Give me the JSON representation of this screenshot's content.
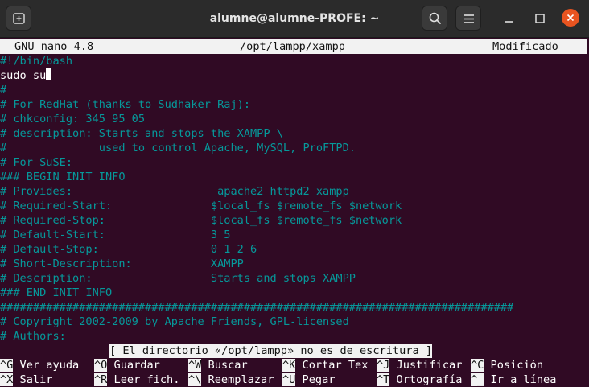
{
  "window": {
    "title": "alumne@alumne-PROFE: ~",
    "accent_close": "#e95420"
  },
  "header": {
    "version": "GNU nano 4.8",
    "filename": "/opt/lampp/xampp",
    "state": "Modificado"
  },
  "lines": [
    {
      "text": "#!/bin/bash",
      "color": "#06989a"
    },
    {
      "text": "sudo su",
      "color": "#ffffff"
    },
    {
      "text": "#",
      "color": "#06989a"
    },
    {
      "text": "# For RedHat (thanks to Sudhaker Raj):",
      "color": "#06989a"
    },
    {
      "text": "# chkconfig: 345 95 05",
      "color": "#06989a"
    },
    {
      "text": "# description: Starts and stops the XAMPP \\",
      "color": "#06989a"
    },
    {
      "text": "#              used to control Apache, MySQL, ProFTPD.",
      "color": "#06989a"
    },
    {
      "text": "# For SuSE:",
      "color": "#06989a"
    },
    {
      "text": "### BEGIN INIT INFO",
      "color": "#06989a"
    },
    {
      "text": "# Provides:                      apache2 httpd2 xampp",
      "color": "#06989a"
    },
    {
      "text": "# Required-Start:               $local_fs $remote_fs $network",
      "color": "#06989a"
    },
    {
      "text": "# Required-Stop:                $local_fs $remote_fs $network",
      "color": "#06989a"
    },
    {
      "text": "# Default-Start:                3 5",
      "color": "#06989a"
    },
    {
      "text": "# Default-Stop:                 0 1 2 6",
      "color": "#06989a"
    },
    {
      "text": "# Short-Description:            XAMPP",
      "color": "#06989a"
    },
    {
      "text": "# Description:                  Starts and stops XAMPP",
      "color": "#06989a"
    },
    {
      "text": "### END INIT INFO",
      "color": "#06989a"
    },
    {
      "text": "##############################################################################",
      "color": "#06989a"
    },
    {
      "text": "# Copyright 2002-2009 by Apache Friends, GPL-licensed",
      "color": "#06989a"
    },
    {
      "text": "# Authors:",
      "color": "#06989a"
    }
  ],
  "status_message": "[ El directorio «/opt/lampp» no es de escritura ]",
  "shortcuts_row1": [
    {
      "key": "^G",
      "label": " Ver ayuda"
    },
    {
      "key": "^O",
      "label": " Guardar"
    },
    {
      "key": "^W",
      "label": " Buscar"
    },
    {
      "key": "^K",
      "label": " Cortar Tex"
    },
    {
      "key": "^J",
      "label": " Justificar"
    },
    {
      "key": "^C",
      "label": " Posición"
    }
  ],
  "shortcuts_row2": [
    {
      "key": "^X",
      "label": " Salir"
    },
    {
      "key": "^R",
      "label": " Leer fich."
    },
    {
      "key": "^\\",
      "label": " Reemplazar"
    },
    {
      "key": "^U",
      "label": " Pegar"
    },
    {
      "key": "^T",
      "label": " Ortografía"
    },
    {
      "key": "^_",
      "label": " Ir a línea"
    }
  ]
}
